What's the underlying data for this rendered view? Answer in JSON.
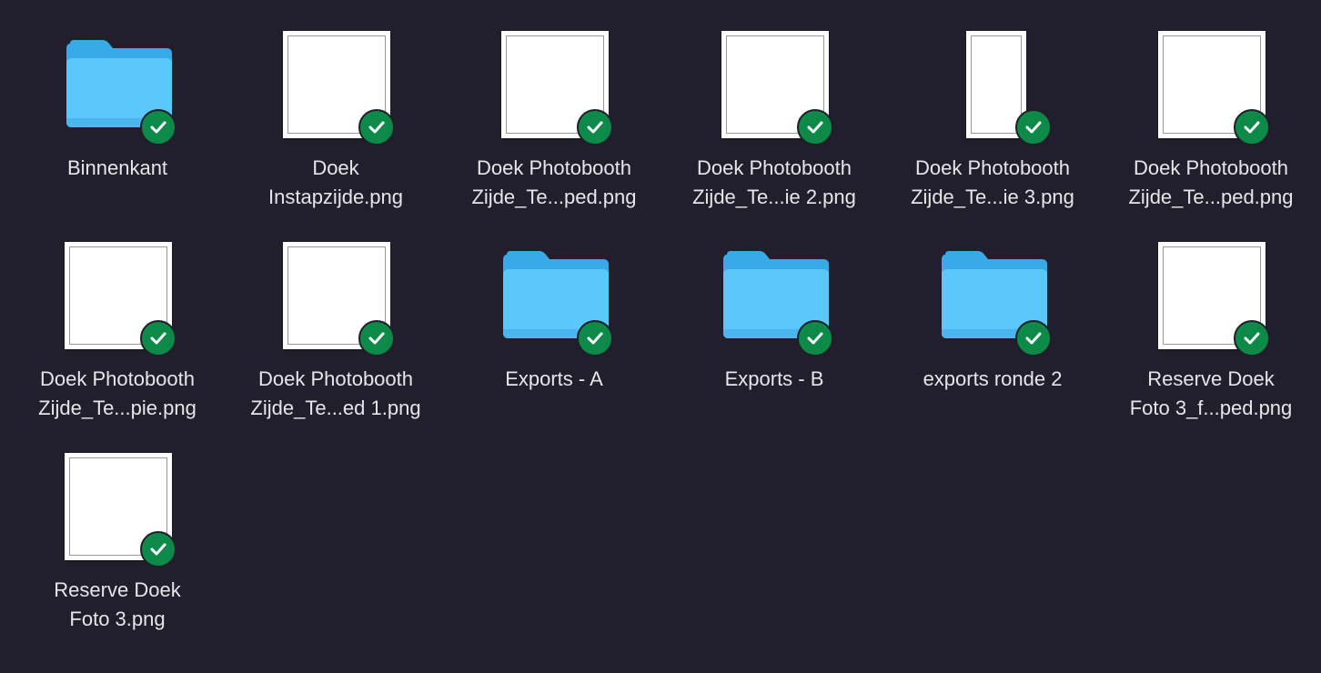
{
  "window": {
    "view": "icon-grid"
  },
  "colors": {
    "background": "#211f2b",
    "folder": "#5ac8fa",
    "sync_check": "#0d8a48",
    "label_text": "#e6e6ea"
  },
  "items": [
    {
      "type": "folder",
      "line1": "Binnenkant",
      "line2": "",
      "status_icon": "synced-check-icon"
    },
    {
      "type": "image",
      "line1": "Doek",
      "line2": "Instapzijde.png",
      "status_icon": "synced-check-icon"
    },
    {
      "type": "image",
      "line1": "Doek Photobooth",
      "line2": "Zijde_Te...ped.png",
      "status_icon": "synced-check-icon"
    },
    {
      "type": "image",
      "line1": "Doek Photobooth",
      "line2": "Zijde_Te...ie 2.png",
      "status_icon": "synced-check-icon"
    },
    {
      "type": "image-narrow",
      "line1": "Doek Photobooth",
      "line2": "Zijde_Te...ie 3.png",
      "status_icon": "synced-check-icon"
    },
    {
      "type": "image",
      "line1": "Doek Photobooth",
      "line2": "Zijde_Te...ped.png",
      "status_icon": "synced-check-icon"
    },
    {
      "type": "image",
      "line1": "Doek Photobooth",
      "line2": "Zijde_Te...pie.png",
      "status_icon": "synced-check-icon"
    },
    {
      "type": "image",
      "line1": "Doek Photobooth",
      "line2": "Zijde_Te...ed 1.png",
      "status_icon": "synced-check-icon"
    },
    {
      "type": "folder",
      "line1": "Exports - A",
      "line2": "",
      "status_icon": "synced-check-icon"
    },
    {
      "type": "folder",
      "line1": "Exports - B",
      "line2": "",
      "status_icon": "synced-check-icon"
    },
    {
      "type": "folder",
      "line1": "exports ronde 2",
      "line2": "",
      "status_icon": "synced-check-icon"
    },
    {
      "type": "image",
      "line1": "Reserve Doek",
      "line2": "Foto 3_f...ped.png",
      "status_icon": "synced-check-icon"
    },
    {
      "type": "image",
      "line1": "Reserve Doek",
      "line2": "Foto 3.png",
      "status_icon": "synced-check-icon"
    }
  ]
}
